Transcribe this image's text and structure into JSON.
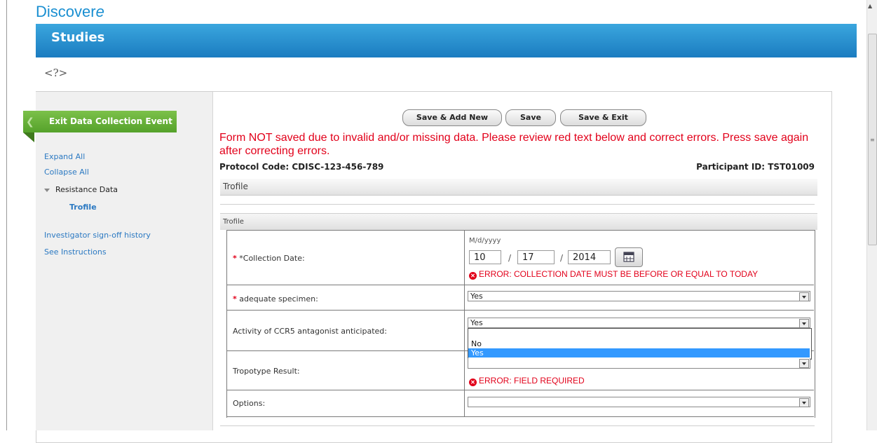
{
  "app": {
    "logo_text": "Discover",
    "logo_tail": "e",
    "section_title": "Studies",
    "help_glyph": "<?>"
  },
  "sidebar": {
    "exit_button": "Exit Data Collection Event",
    "expand_all": "Expand All",
    "collapse_all": "Collapse All",
    "tree_node": "Resistance Data",
    "tree_child": "Trofile",
    "signoff_link": "Investigator sign-off history",
    "instructions_link": "See Instructions"
  },
  "toolbar": {
    "save_add_new": "Save & Add New",
    "save": "Save",
    "save_exit": "Save & Exit"
  },
  "form": {
    "error_message": "Form NOT saved due to invalid and/or missing data. Please review red text below and correct errors. Press save again after correcting errors.",
    "protocol_code": "Protocol Code: CDISC-123-456-789",
    "participant_id": "Participant ID: TST01009",
    "section_title": "Trofile",
    "subsection_title": "Trofile",
    "fields": {
      "collection_date": {
        "required_mark": "*",
        "label": "*Collection Date:",
        "format": "M/d/yyyy",
        "month": "10",
        "day": "17",
        "year": "2014",
        "sep": "/",
        "error": "ERROR: COLLECTION DATE MUST BE BEFORE OR EQUAL TO TODAY"
      },
      "adequate_specimen": {
        "required_mark": "*",
        "label": "adequate specimen:",
        "value": "Yes"
      },
      "ccr5": {
        "label": "Activity of CCR5 antagonist anticipated:",
        "value": "Yes",
        "options": [
          "",
          "No",
          "Yes"
        ]
      },
      "tropotype": {
        "label": "Tropotype Result:",
        "value": "",
        "error": "ERROR: FIELD REQUIRED"
      },
      "options": {
        "label": "Options:",
        "value": ""
      }
    },
    "error_icon": "x-circle-icon"
  },
  "colors": {
    "error": "#e2001a",
    "banner": "#1b7cc0",
    "exit_button": "#55a22b",
    "link": "#2b79c2",
    "selected_option": "#3399ff"
  }
}
